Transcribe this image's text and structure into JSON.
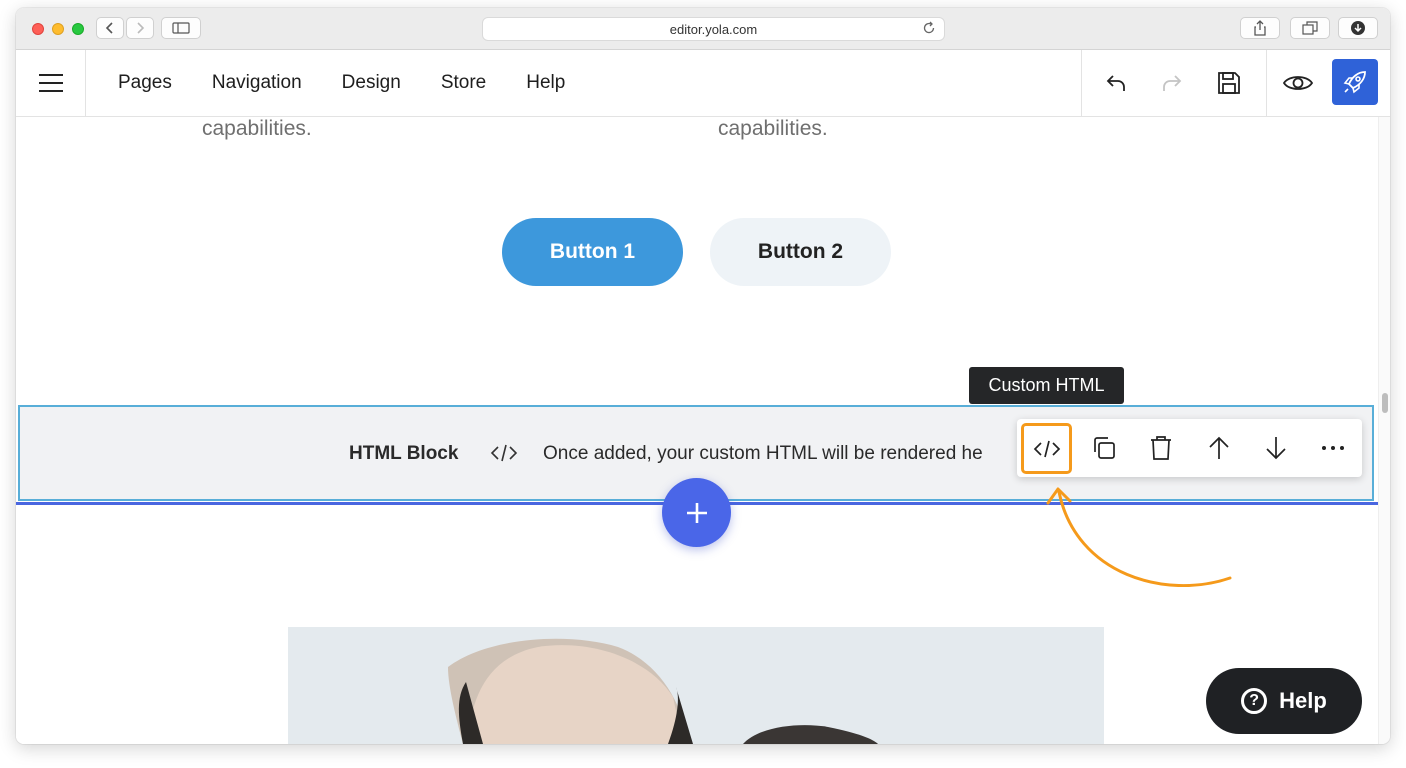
{
  "browser": {
    "url": "editor.yola.com"
  },
  "topbar": {
    "nav": [
      "Pages",
      "Navigation",
      "Design",
      "Store",
      "Help"
    ]
  },
  "content": {
    "caption_left": "capabilities.",
    "caption_right": "capabilities.",
    "button1_label": "Button 1",
    "button2_label": "Button 2",
    "tooltip": "Custom HTML",
    "html_block": {
      "title": "HTML Block",
      "text": "Once added, your custom HTML will be rendered he"
    },
    "help_label": "Help"
  },
  "colors": {
    "accent": "#4a66e8",
    "publish": "#2f62d8",
    "button1": "#3d98dc",
    "highlight": "#f59a1b",
    "block_border": "#58aed8"
  },
  "icons": {
    "toolbar": [
      "code-icon",
      "copy-icon",
      "trash-icon",
      "arrow-up-icon",
      "arrow-down-icon",
      "more-icon"
    ]
  }
}
